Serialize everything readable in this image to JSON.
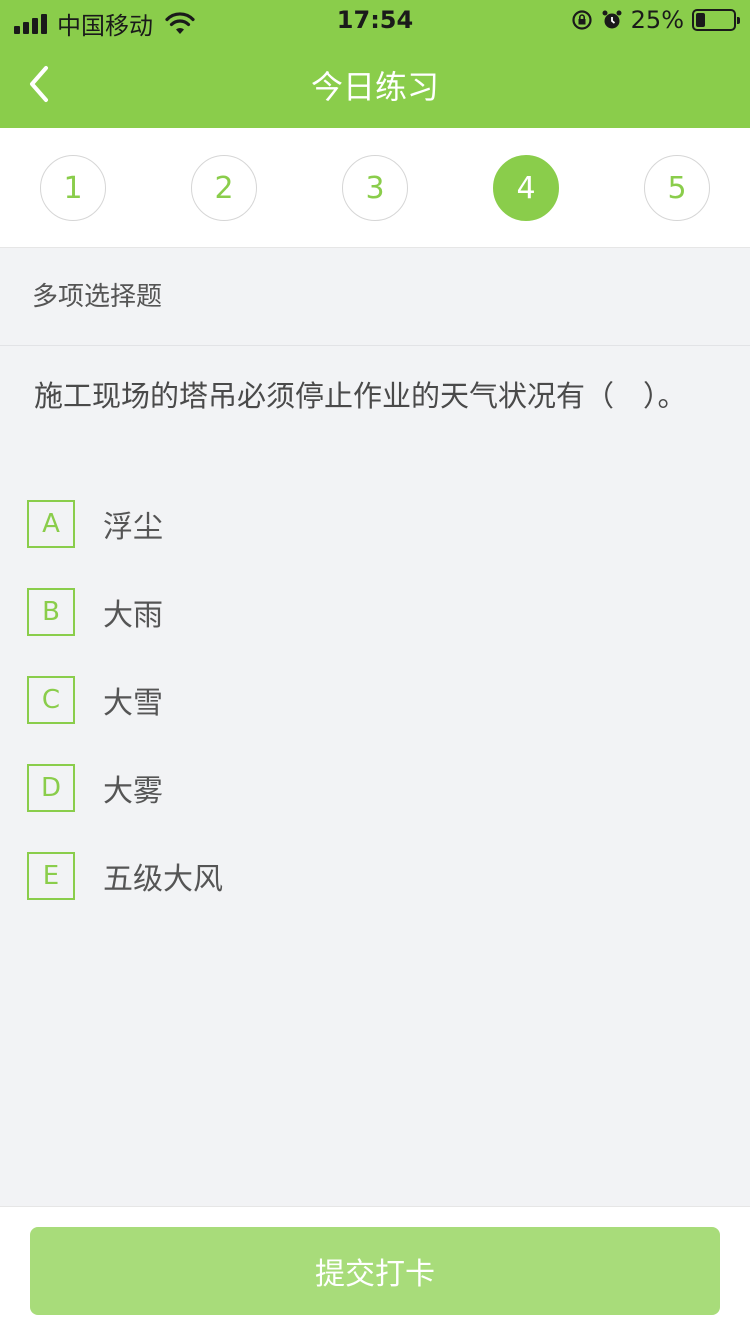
{
  "status_bar": {
    "carrier": "中国移动",
    "time": "17:54",
    "battery_percent": "25%",
    "battery_level": 0.25,
    "icons": [
      "signal-icon",
      "wifi-icon",
      "orientation-lock-icon",
      "alarm-icon",
      "battery-icon"
    ]
  },
  "header": {
    "title": "今日练习",
    "back_icon": "chevron-left-icon"
  },
  "steps": {
    "items": [
      "1",
      "2",
      "3",
      "4",
      "5"
    ],
    "active": "4"
  },
  "question": {
    "type": "多项选择题",
    "text": "施工现场的塔吊必须停止作业的天气状况有（　）。",
    "options": [
      {
        "letter": "A",
        "text": "浮尘"
      },
      {
        "letter": "B",
        "text": "大雨"
      },
      {
        "letter": "C",
        "text": "大雪"
      },
      {
        "letter": "D",
        "text": "大雾"
      },
      {
        "letter": "E",
        "text": "五级大风"
      }
    ]
  },
  "footer": {
    "submit_label": "提交打卡"
  },
  "colors": {
    "accent": "#8acd4b",
    "button": "#a8dc7a",
    "background": "#f2f3f5"
  }
}
